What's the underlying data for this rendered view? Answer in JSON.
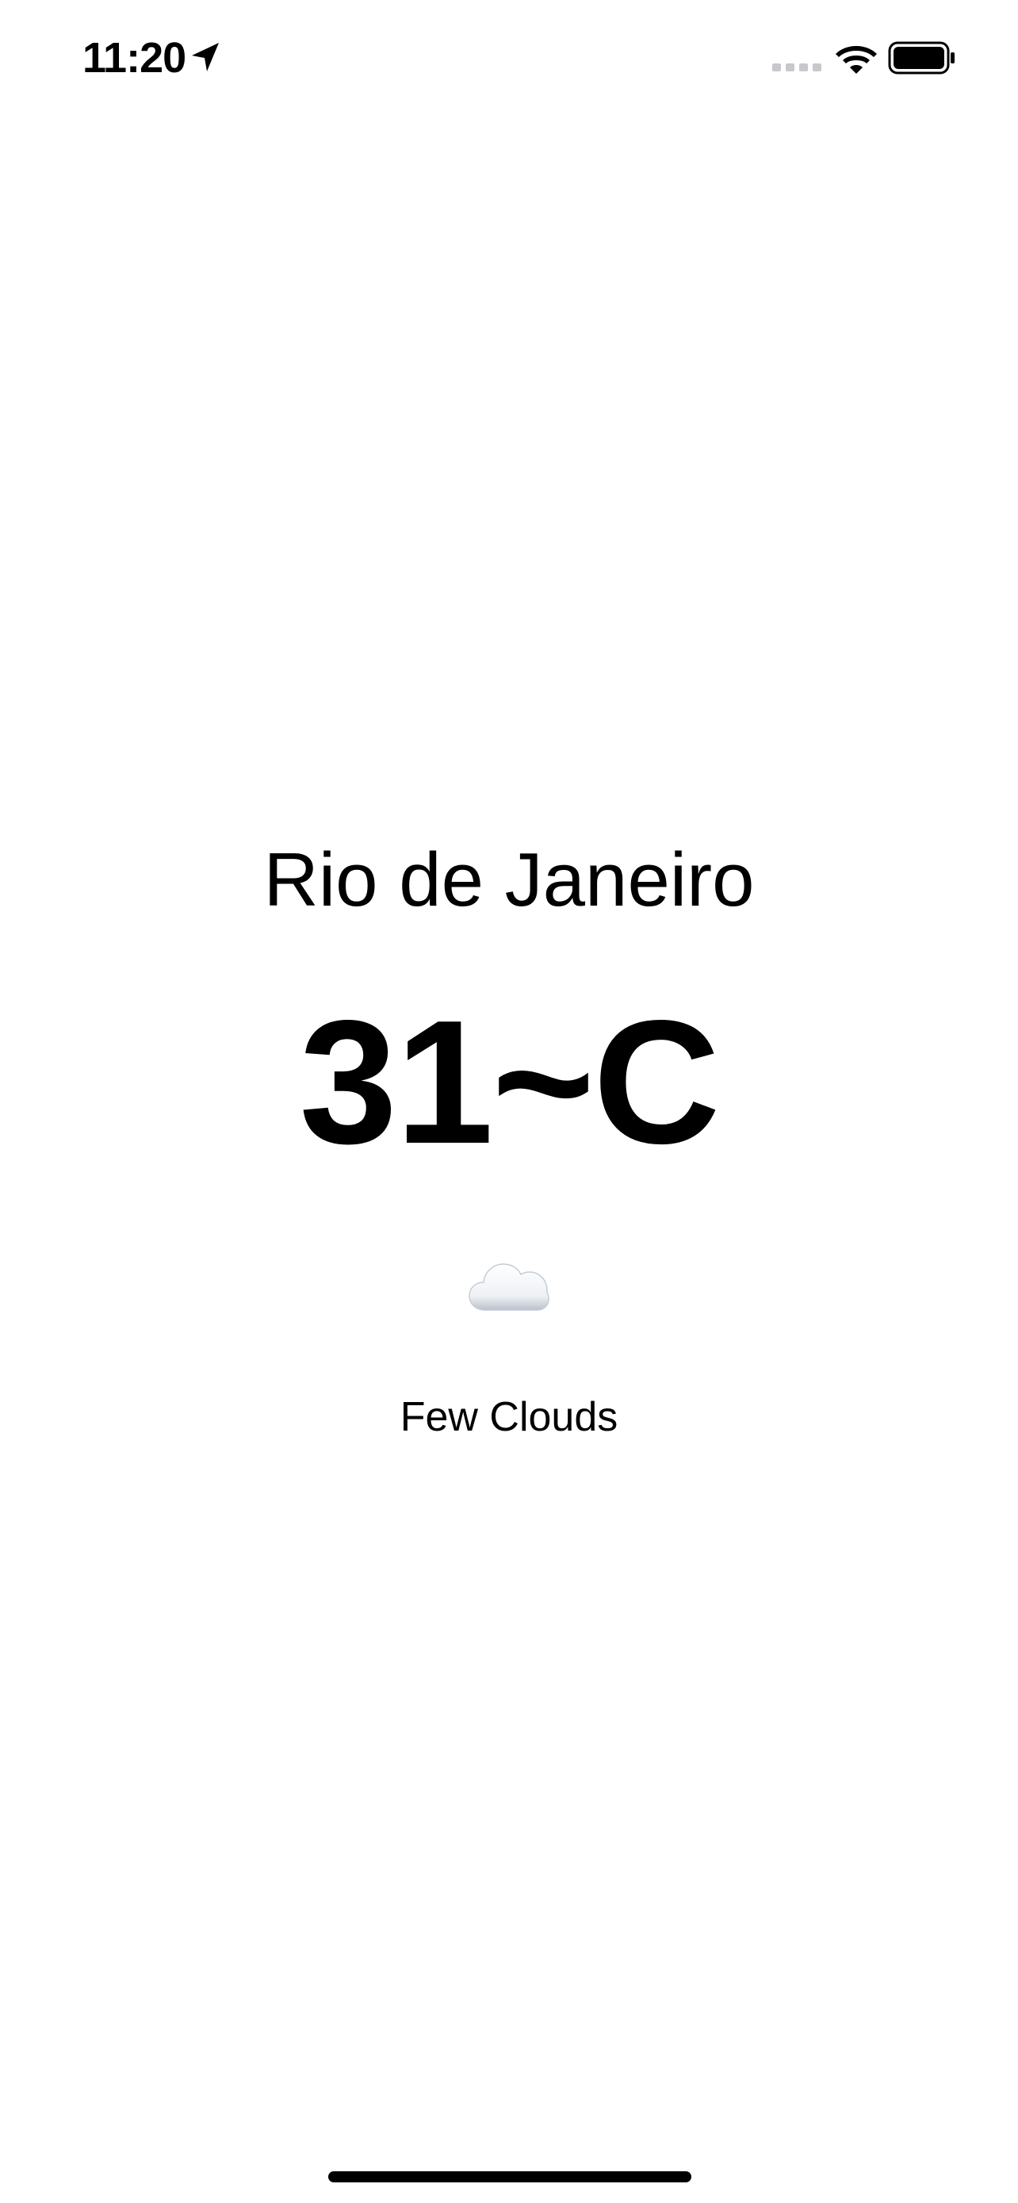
{
  "status_bar": {
    "time": "11:20",
    "icons": [
      "location-arrow-icon",
      "cellular-signal-icon",
      "wifi-icon",
      "battery-icon"
    ]
  },
  "weather": {
    "city": "Rio de Janeiro",
    "temperature": "31~C",
    "condition_icon": "cloud-icon",
    "description": "Few Clouds"
  },
  "colors": {
    "background": "#ffffff",
    "text": "#000000",
    "signal_inactive": "#c7c7cc"
  }
}
